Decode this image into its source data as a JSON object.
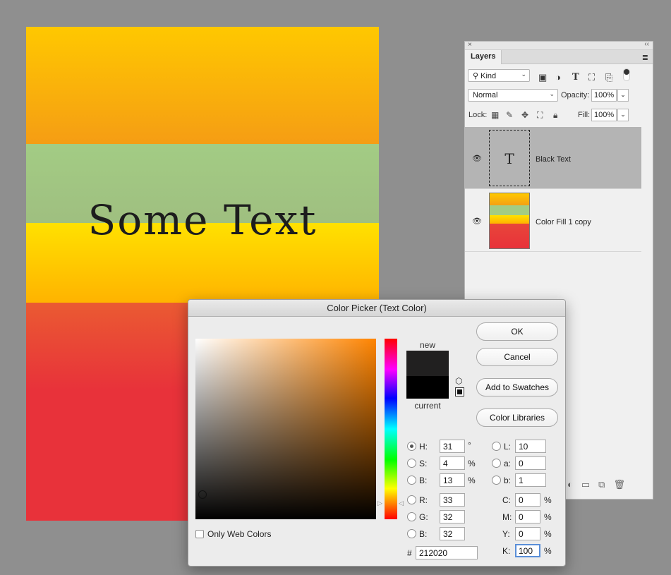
{
  "canvas": {
    "text": "Some Text"
  },
  "layers_panel": {
    "close_glyph": "×",
    "collapse_glyph": "‹‹",
    "tab": "Layers",
    "menu_glyph": "≣",
    "filter": {
      "kind_label": "Kind"
    },
    "blend_mode": "Normal",
    "opacity_label": "Opacity:",
    "opacity_value": "100%",
    "lock_label": "Lock:",
    "fill_label": "Fill:",
    "fill_value": "100%",
    "layers": [
      {
        "name": "Black Text",
        "thumb_glyph": "T",
        "selected": true
      },
      {
        "name": "Color Fill 1 copy",
        "selected": false
      }
    ]
  },
  "color_picker": {
    "title": "Color Picker (Text Color)",
    "new_label": "new",
    "current_label": "current",
    "new_color": "#212020",
    "current_color": "#000000",
    "buttons": {
      "ok": "OK",
      "cancel": "Cancel",
      "add_swatches": "Add to Swatches",
      "libraries": "Color Libraries"
    },
    "hsb": {
      "h_label": "H:",
      "h_value": "31",
      "h_unit": "°",
      "s_label": "S:",
      "s_value": "4",
      "s_unit": "%",
      "b_label": "B:",
      "b_value": "13",
      "b_unit": "%"
    },
    "rgb": {
      "r_label": "R:",
      "r_value": "33",
      "g_label": "G:",
      "g_value": "32",
      "b_label": "B:",
      "b_value": "32"
    },
    "lab": {
      "l_label": "L:",
      "l_value": "10",
      "a_label": "a:",
      "a_value": "0",
      "b_label": "b:",
      "b_value": "1"
    },
    "cmyk": {
      "c_label": "C:",
      "c_value": "0",
      "m_label": "M:",
      "m_value": "0",
      "y_label": "Y:",
      "y_value": "0",
      "k_label": "K:",
      "k_value": "100",
      "unit": "%"
    },
    "hex_label": "#",
    "hex_value": "212020",
    "only_web_colors": "Only Web Colors"
  }
}
